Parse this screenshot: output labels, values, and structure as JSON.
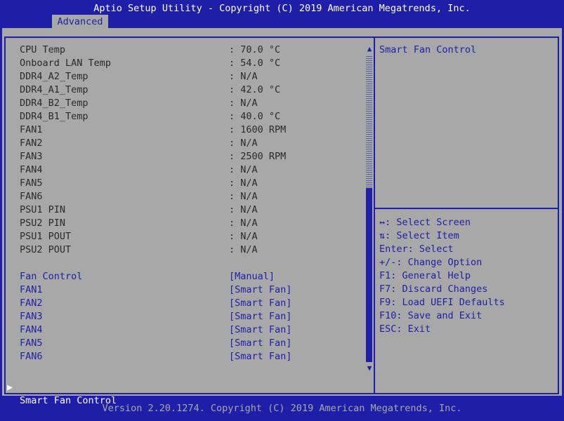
{
  "title": "Aptio Setup Utility - Copyright (C) 2019 American Megatrends, Inc.",
  "active_tab": "Advanced",
  "sensors": [
    {
      "label": "CPU Temp",
      "value": ": 70.0 °C"
    },
    {
      "label": "Onboard LAN Temp",
      "value": ": 54.0 °C"
    },
    {
      "label": "DDR4_A2_Temp",
      "value": ": N/A"
    },
    {
      "label": "DDR4_A1_Temp",
      "value": ": 42.0 °C"
    },
    {
      "label": "DDR4_B2_Temp",
      "value": ": N/A"
    },
    {
      "label": "DDR4_B1_Temp",
      "value": ": 40.0 °C"
    },
    {
      "label": "FAN1",
      "value": ": 1600 RPM"
    },
    {
      "label": "FAN2",
      "value": ": N/A"
    },
    {
      "label": "FAN3",
      "value": ": 2500 RPM"
    },
    {
      "label": "FAN4",
      "value": ": N/A"
    },
    {
      "label": "FAN5",
      "value": ": N/A"
    },
    {
      "label": "FAN6",
      "value": ": N/A"
    },
    {
      "label": "PSU1 PIN",
      "value": ": N/A"
    },
    {
      "label": "PSU2 PIN",
      "value": ": N/A"
    },
    {
      "label": "PSU1 POUT",
      "value": ": N/A"
    },
    {
      "label": "PSU2 POUT",
      "value": ": N/A"
    }
  ],
  "settings": [
    {
      "label": "Fan Control",
      "value": "[Manual]"
    },
    {
      "label": "FAN1",
      "value": "[Smart Fan]"
    },
    {
      "label": "FAN2",
      "value": "[Smart Fan]"
    },
    {
      "label": "FAN3",
      "value": "[Smart Fan]"
    },
    {
      "label": "FAN4",
      "value": "[Smart Fan]"
    },
    {
      "label": "FAN5",
      "value": "[Smart Fan]"
    },
    {
      "label": "FAN6",
      "value": "[Smart Fan]"
    }
  ],
  "selected_item": {
    "marker": "▶",
    "label": "Smart Fan Control"
  },
  "scrollbar": {
    "up_arrow": "▲",
    "down_arrow": "▼"
  },
  "help": {
    "title": "Smart Fan Control",
    "keys": [
      "↔: Select Screen",
      "⇅: Select Item",
      "Enter: Select",
      "+/-: Change Option",
      "F1: General Help",
      "F7: Discard Changes",
      "F9: Load UEFI Defaults",
      "F10: Save and Exit",
      "ESC: Exit"
    ]
  },
  "footer": "Version 2.20.1274. Copyright (C) 2019 American Megatrends, Inc."
}
